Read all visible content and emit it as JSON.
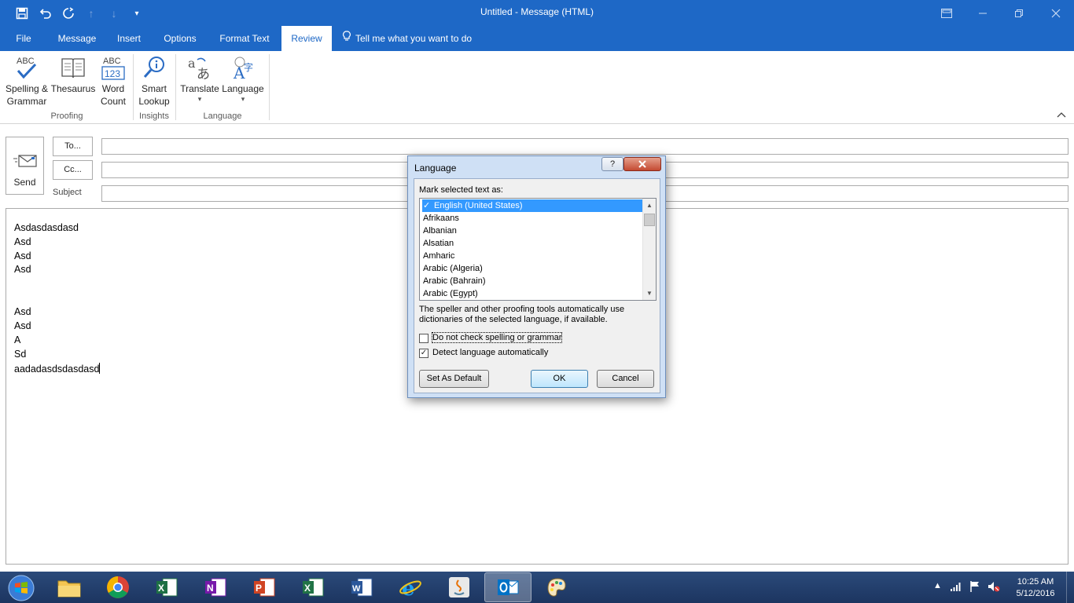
{
  "window": {
    "title": "Untitled - Message (HTML)"
  },
  "tabs": [
    {
      "label": "File"
    },
    {
      "label": "Message"
    },
    {
      "label": "Insert"
    },
    {
      "label": "Options"
    },
    {
      "label": "Format Text"
    },
    {
      "label": "Review"
    }
  ],
  "tell_me": "Tell me what you want to do",
  "ribbon": {
    "spelling_line1": "Spelling &",
    "spelling_line2": "Grammar",
    "thesaurus": "Thesaurus",
    "wordcount_line1": "Word",
    "wordcount_line2": "Count",
    "smart_line1": "Smart",
    "smart_line2": "Lookup",
    "translate": "Translate",
    "language": "Language",
    "abc_text": "ABC",
    "abc_num": "123",
    "group_proofing": "Proofing",
    "group_insights": "Insights",
    "group_language": "Language"
  },
  "compose": {
    "send_label": "Send",
    "to_label": "To...",
    "cc_label": "Cc...",
    "subject_label": "Subject",
    "to_value": "",
    "cc_value": "",
    "subject_value": "",
    "body_lines": [
      "Asdasdasdasd",
      "Asd",
      "Asd",
      "Asd",
      "",
      "",
      "Asd",
      "Asd",
      "A",
      "Sd",
      "aadadasdsdasdasd"
    ]
  },
  "dialog": {
    "title": "Language",
    "help": "?",
    "close": "X",
    "mark_label": "Mark selected text as:",
    "languages": [
      "English (United States)",
      "Afrikaans",
      "Albanian",
      "Alsatian",
      "Amharic",
      "Arabic (Algeria)",
      "Arabic (Bahrain)",
      "Arabic (Egypt)"
    ],
    "selected_language": "English (United States)",
    "description": "The speller and other proofing tools automatically use dictionaries of the selected language, if available.",
    "no_check_label": "Do not check spelling or grammar",
    "no_check_checked": false,
    "detect_label": "Detect language automatically",
    "detect_checked": true,
    "set_default": "Set As Default",
    "ok": "OK",
    "cancel": "Cancel"
  },
  "taskbar": {
    "time": "10:25 AM",
    "date": "5/12/2016"
  },
  "colors": {
    "accent": "#1e68c6",
    "selection": "#3399ff"
  }
}
